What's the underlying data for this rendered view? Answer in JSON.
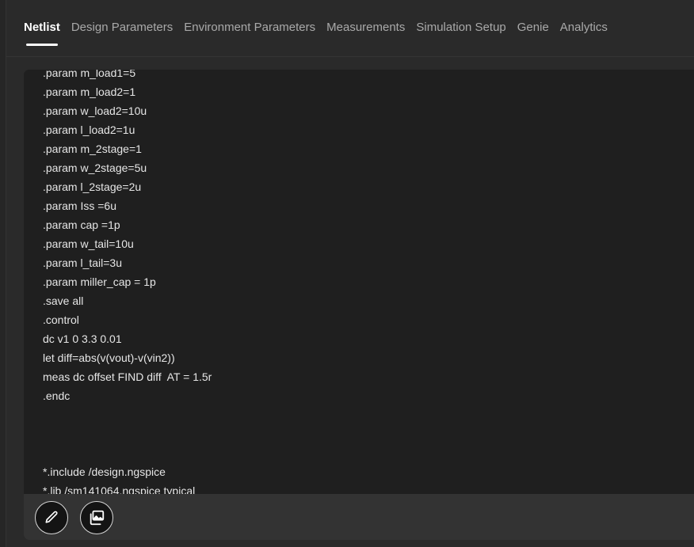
{
  "tabs": [
    {
      "label": "Netlist",
      "active": true
    },
    {
      "label": "Design Parameters",
      "active": false
    },
    {
      "label": "Environment Parameters",
      "active": false
    },
    {
      "label": "Measurements",
      "active": false
    },
    {
      "label": "Simulation Setup",
      "active": false
    },
    {
      "label": "Genie",
      "active": false
    },
    {
      "label": "Analytics",
      "active": false
    }
  ],
  "netlist": {
    "lines": [
      ".param m_load1=5",
      ".param m_load2=1",
      ".param w_load2=10u",
      ".param l_load2=1u",
      ".param m_2stage=1",
      ".param w_2stage=5u",
      ".param l_2stage=2u",
      ".param Iss =6u",
      ".param cap =1p",
      ".param w_tail=10u",
      ".param l_tail=3u",
      ".param miller_cap = 1p",
      ".save all",
      ".control",
      "dc v1 0 3.3 0.01",
      "let diff=abs(v(vout)-v(vin2))",
      "meas dc offset FIND diff  AT = 1.5r",
      ".endc",
      "",
      "",
      "",
      "*.include /design.ngspice",
      "*.lib /sm141064.ngspice typical"
    ]
  },
  "toolbar": {
    "edit_icon": "pencil-icon",
    "gallery_icon": "image-gallery-icon"
  },
  "colors": {
    "background": "#2a2a2a",
    "editor_background": "#1f1f1f",
    "toolbar_background": "#333333",
    "active_tab": "#ffffff",
    "inactive_tab": "#a9a9a9"
  }
}
